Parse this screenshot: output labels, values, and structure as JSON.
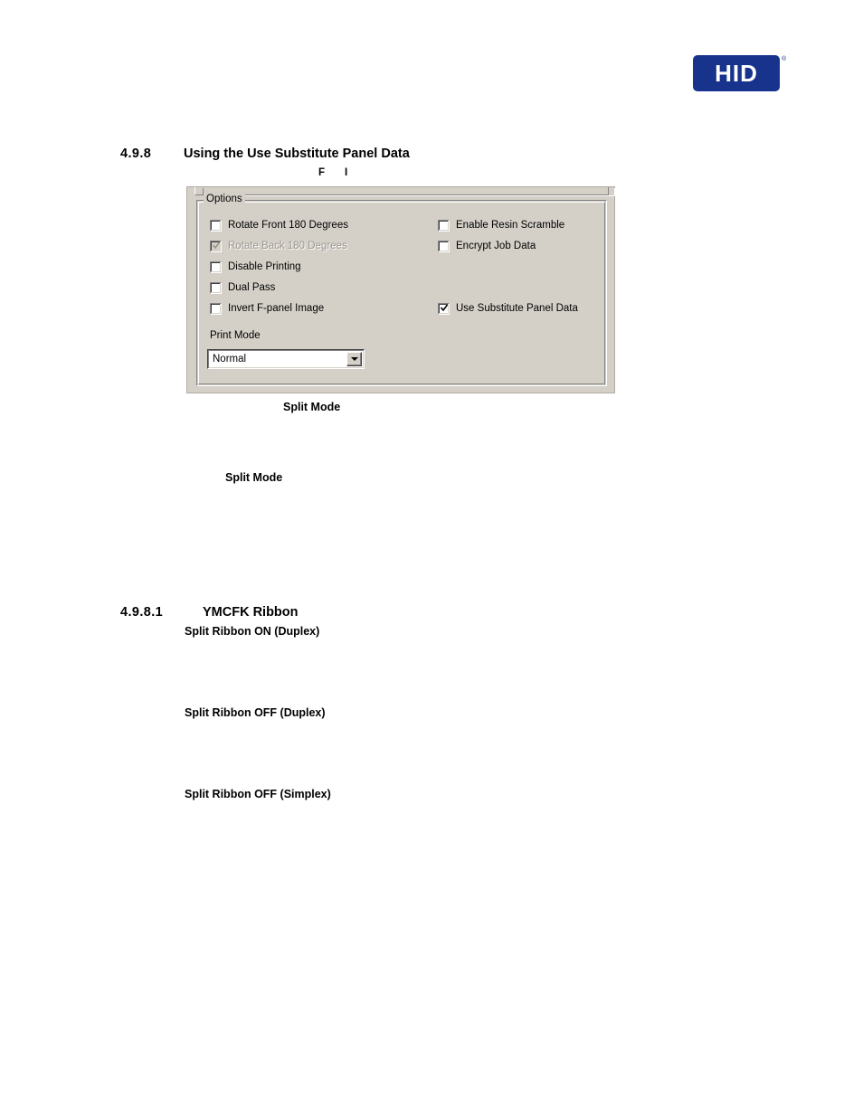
{
  "brand": {
    "logo_text": "HID",
    "logo_color": "#17338c",
    "trademark": "®"
  },
  "headings": {
    "section_number": "4.9.8",
    "section_title": "Using the Use Substitute Panel Data",
    "subsection_number": "4.9.8.1",
    "subsection_title": "YMCFK Ribbon"
  },
  "fragments": {
    "frag_f": "F",
    "frag_i": "I"
  },
  "dialog": {
    "groupbox_label": "Options",
    "checkboxes_left": [
      {
        "label": "Rotate Front 180 Degrees",
        "checked": false,
        "disabled": false
      },
      {
        "label": "Rotate Back 180 Degrees",
        "checked": true,
        "disabled": true
      },
      {
        "label": "Disable Printing",
        "checked": false,
        "disabled": false
      },
      {
        "label": "Dual Pass",
        "checked": false,
        "disabled": false
      },
      {
        "label": "Invert F-panel Image",
        "checked": false,
        "disabled": false
      }
    ],
    "checkboxes_right": [
      {
        "label": "Enable Resin Scramble",
        "checked": false,
        "disabled": false
      },
      {
        "label": "Encrypt Job Data",
        "checked": false,
        "disabled": false
      },
      {
        "label": "Use Substitute Panel Data",
        "checked": true,
        "disabled": false
      }
    ],
    "print_mode": {
      "label": "Print Mode",
      "value": "Normal",
      "options": [
        "Normal"
      ]
    },
    "colors": {
      "face": "#d4d0c8",
      "shadow": "#848284",
      "highlight": "#ffffff",
      "disabled_text": "#9a968e"
    }
  },
  "captions": {
    "figure_caption": "Split Mode",
    "body_split_mode": "Split Mode",
    "split_ribbon_on_duplex": "Split Ribbon ON (Duplex)",
    "split_ribbon_off_duplex": "Split Ribbon OFF (Duplex)",
    "split_ribbon_off_simplex": "Split Ribbon OFF (Simplex)"
  }
}
